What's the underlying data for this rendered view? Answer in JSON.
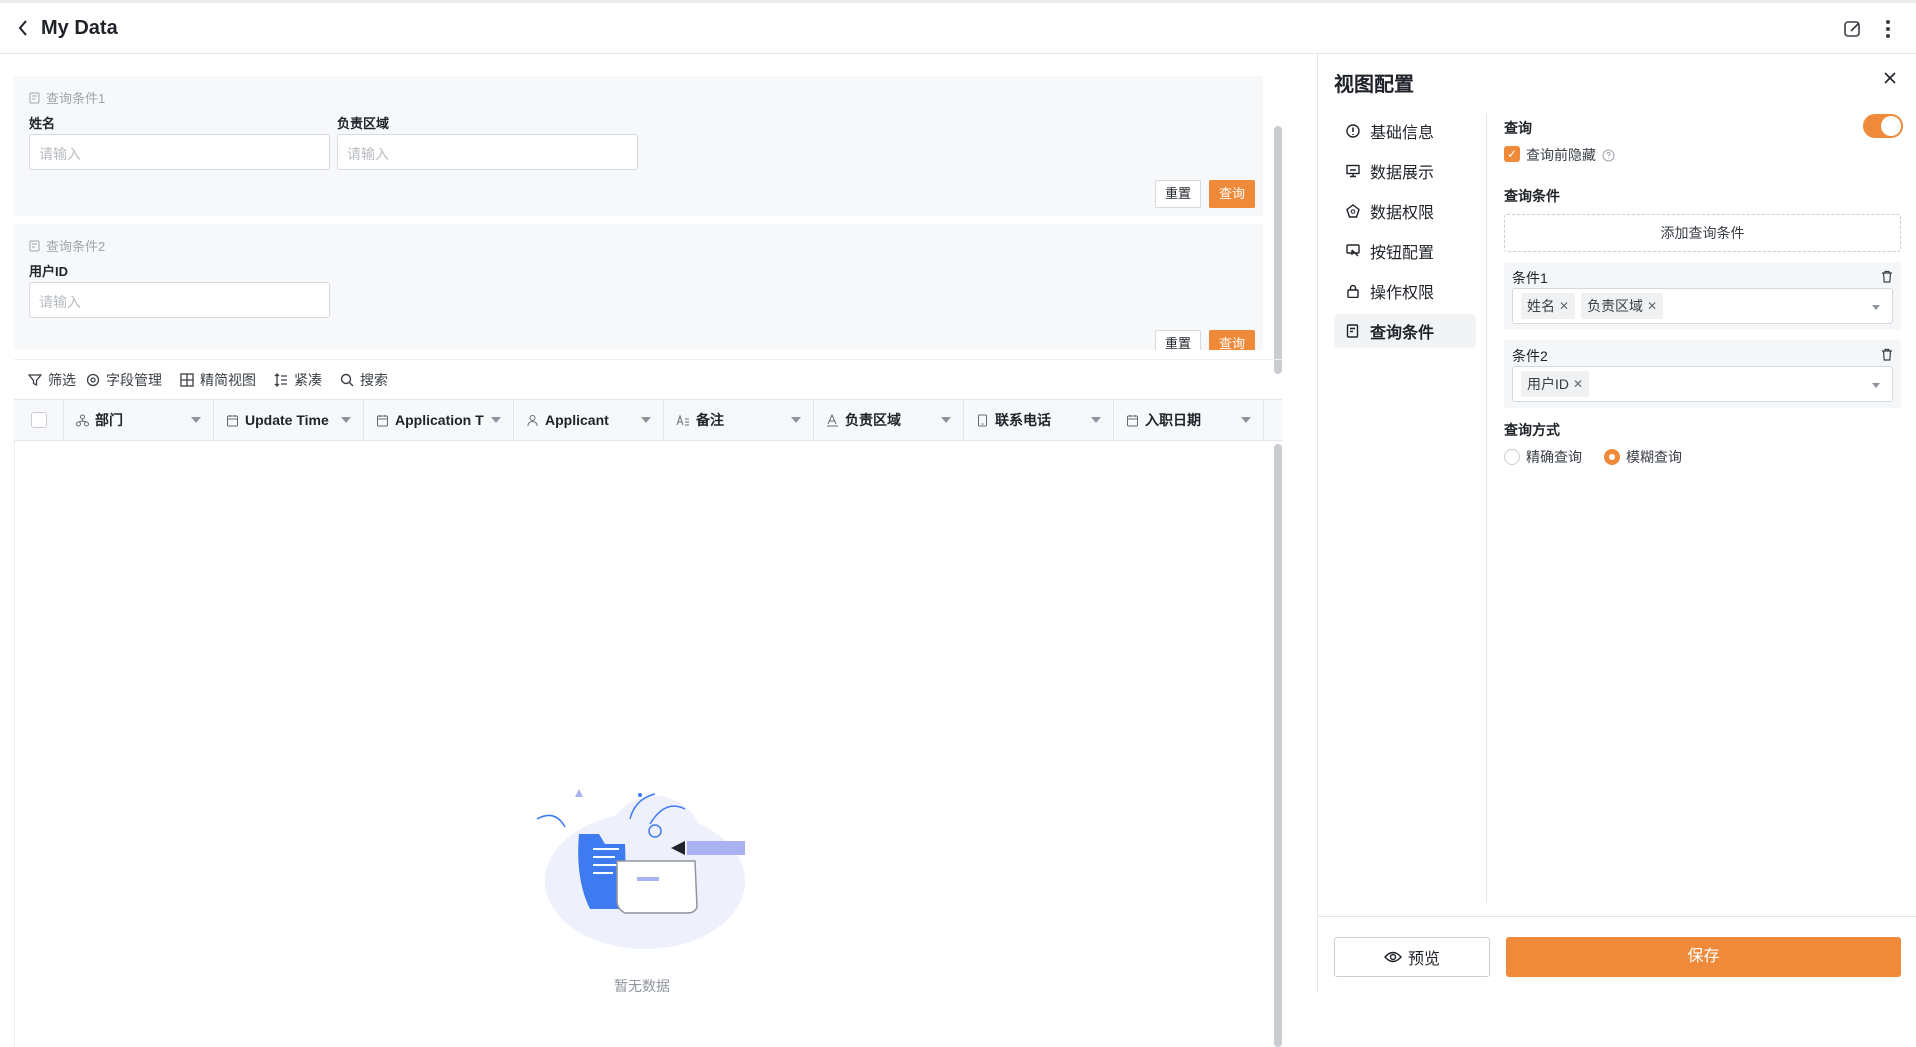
{
  "header": {
    "title": "My Data"
  },
  "query": {
    "card1": {
      "title": "查询条件1",
      "field1_label": "姓名",
      "field1_placeholder": "请输入",
      "field2_label": "负责区域",
      "field2_placeholder": "请输入",
      "reset": "重置",
      "submit": "查询"
    },
    "card2": {
      "title": "查询条件2",
      "field1_label": "用户ID",
      "field1_placeholder": "请输入",
      "reset": "重置",
      "submit": "查询"
    }
  },
  "toolbar": {
    "filter": "筛选",
    "fields": "字段管理",
    "view": "精简视图",
    "compact": "紧凑",
    "search": "搜索"
  },
  "table": {
    "columns": [
      {
        "label": "部门",
        "icon": "org-icon"
      },
      {
        "label": "Update Time",
        "icon": "calendar-icon"
      },
      {
        "label": "Application T",
        "icon": "calendar-icon"
      },
      {
        "label": "Applicant",
        "icon": "user-icon"
      },
      {
        "label": "备注",
        "icon": "text-icon"
      },
      {
        "label": "负责区域",
        "icon": "text-a-icon"
      },
      {
        "label": "联系电话",
        "icon": "phone-icon"
      },
      {
        "label": "入职日期",
        "icon": "calendar-icon"
      }
    ],
    "empty_text": "暂无数据"
  },
  "panel": {
    "title": "视图配置",
    "menu": [
      {
        "label": "基础信息",
        "icon": "info-icon"
      },
      {
        "label": "数据展示",
        "icon": "display-icon"
      },
      {
        "label": "数据权限",
        "icon": "permission-icon"
      },
      {
        "label": "按钮配置",
        "icon": "button-config-icon"
      },
      {
        "label": "操作权限",
        "icon": "lock-icon"
      },
      {
        "label": "查询条件",
        "icon": "query-icon"
      }
    ],
    "query_label": "查询",
    "query_enabled": true,
    "hide_before_query": "查询前隐藏",
    "conditions_label": "查询条件",
    "add_condition": "添加查询条件",
    "conditions": [
      {
        "name": "条件1",
        "tags": [
          "姓名",
          "负责区域"
        ]
      },
      {
        "name": "条件2",
        "tags": [
          "用户ID"
        ]
      }
    ],
    "mode_label": "查询方式",
    "mode_exact": "精确查询",
    "mode_fuzzy": "模糊查询",
    "mode_selected": "模糊查询",
    "preview": "预览",
    "save": "保存"
  },
  "colors": {
    "accent": "#ee8a3a",
    "border": "#e5e6eb"
  }
}
